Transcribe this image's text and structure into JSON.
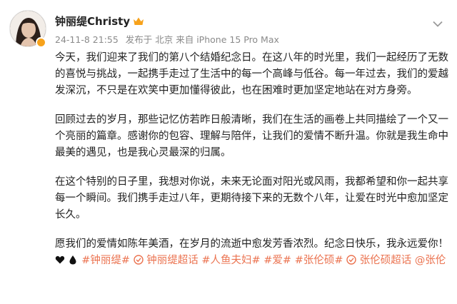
{
  "user": {
    "name": "钟丽缇Christy",
    "timestamp": "24-11-8 21:55",
    "source": "发布于 北京 来自 iPhone 15 Pro Max"
  },
  "post": {
    "paragraphs": [
      "今天，我们迎来了我们的第八个结婚纪念日。在这八年的时光里，我们一起经历了无数的喜悦与挑战，一起携手走过了生活中的每一个高峰与低谷。每一年过去，我们的爱越发深沉，不只是在欢笑中更加懂得彼此，也在困难时更加坚定地站在对方身旁。",
      "回顾过去的岁月，那些记忆仿若昨日般清晰，我们在生活的画卷上共同描绘了一个又一个亮丽的篇章。感谢你的包容、理解与陪伴，让我们的爱情不断升温。你就是我生命中最美的遇见，也是我心灵最深的归属。",
      "在这个特别的日子里，我想对你说，未来无论面对阳光或风雨，我都希望和你一起共享每一个瞬间。我们携手走过八年，更期待接下来的无数个八年，让爱在时光中愈加坚定长久。"
    ],
    "last_text": "愿我们的爱情如陈年美酒，在岁月的流逝中愈发芳香浓烈。纪念日快乐，我永远爱你！",
    "tags": [
      "#钟丽缇#",
      "钟丽缇超话",
      "#人鱼夫妇#",
      "#爱#",
      "#张伦硕#",
      "张伦硕超话",
      "@张伦"
    ]
  },
  "colors": {
    "tag": "#eb7350",
    "meta": "#8a8a8a",
    "badge": "#f7a21b"
  },
  "icons": {
    "member_badge": "crown-icon",
    "chevron": "chevron-down-icon",
    "heart": "black-heart-emoji",
    "drop": "water-drop-emoji",
    "super_topic": "super-topic-icon"
  }
}
